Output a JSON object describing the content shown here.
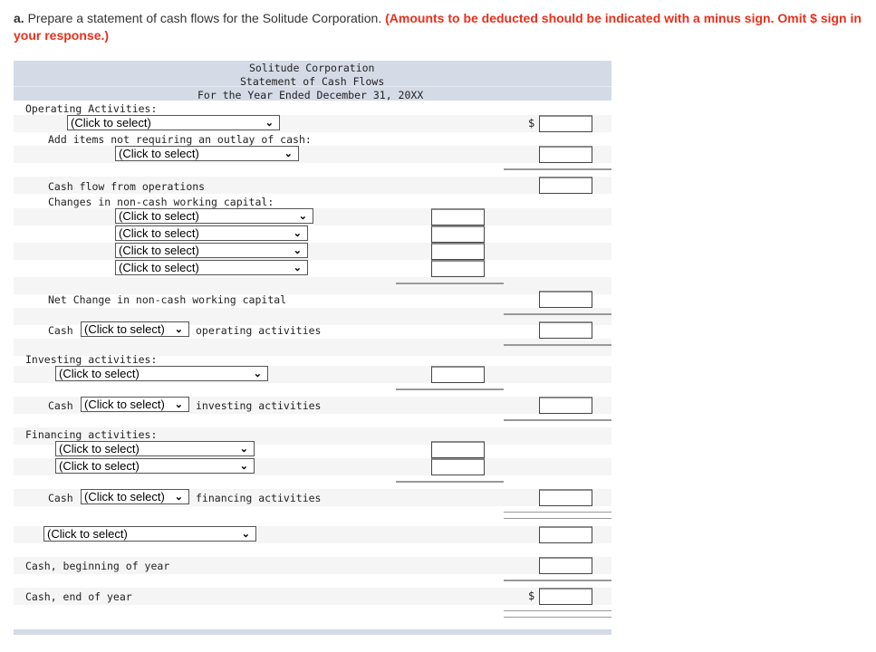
{
  "instructions": {
    "prefix": "a.",
    "text": " Prepare a statement of cash flows for the Solitude Corporation. ",
    "note": "(Amounts to be deducted should be indicated with a minus sign. Omit $ sign in your response.)"
  },
  "header": {
    "company": "Solitude Corporation",
    "statement": "Statement of Cash Flows",
    "period": "For the Year Ended December 31, 20XX"
  },
  "labels": {
    "operating": "Operating Activities:",
    "add_items": "Add items not requiring an outlay of cash:",
    "cash_flow_ops": "Cash flow from operations",
    "changes_wc": "Changes in non-cash working capital:",
    "net_change_wc": "Net Change in non-cash working capital",
    "cash": "Cash",
    "operating_activities": "operating activities",
    "investing": "Investing activities:",
    "investing_activities": "investing activities",
    "financing": "Financing activities:",
    "financing_activities": "financing activities",
    "cash_beginning": "Cash, beginning of year",
    "cash_end": "Cash, end of year"
  },
  "select_placeholder": "(Click to select)",
  "currency_symbol": "$",
  "chevron": "❯"
}
